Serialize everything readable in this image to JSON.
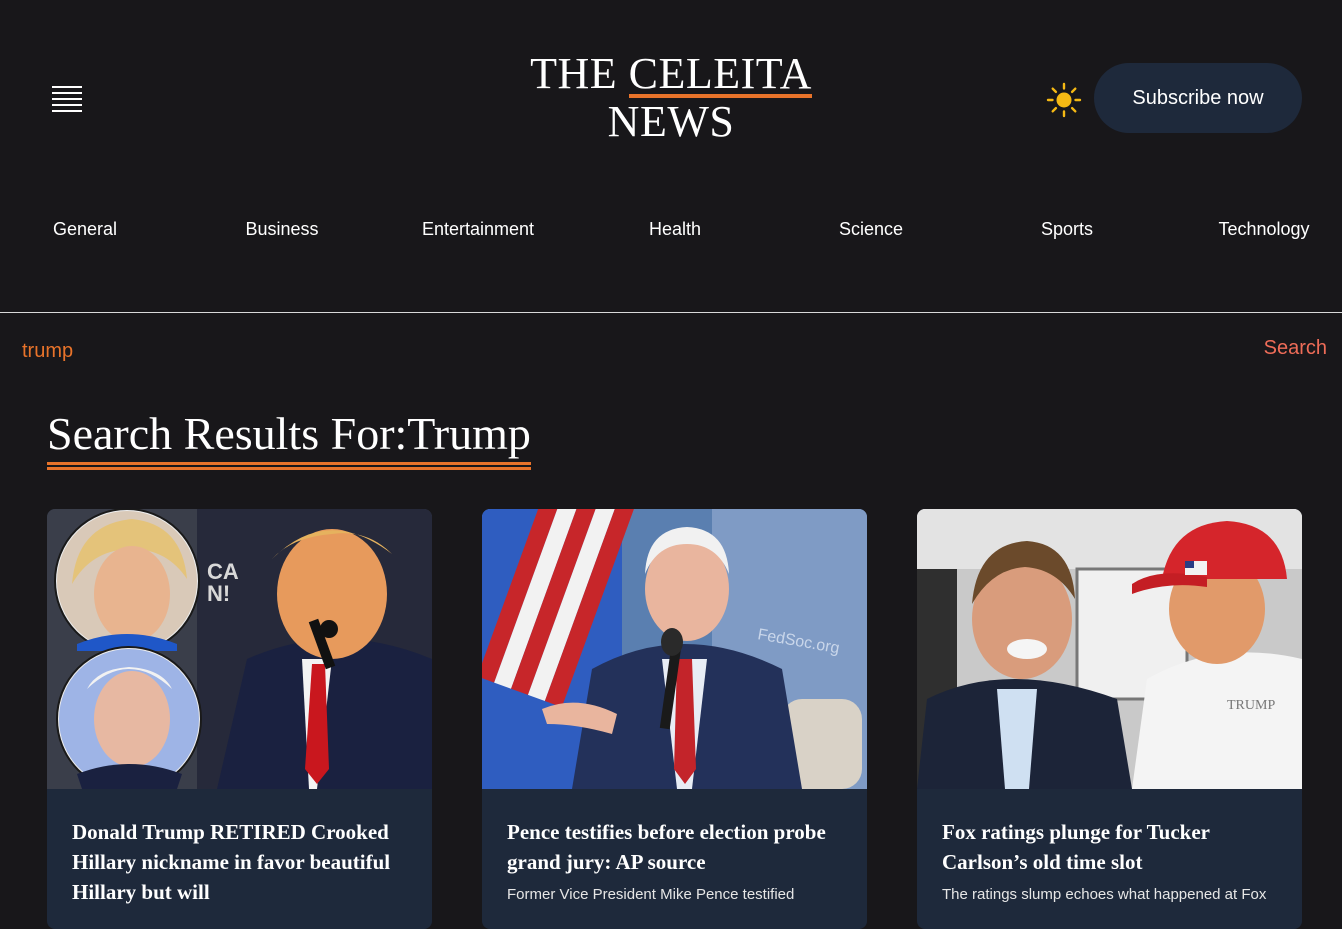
{
  "header": {
    "logo_line1_prefix": "THE ",
    "logo_line1_accent": "CELEITA",
    "logo_line2": "NEWS",
    "subscribe_label": "Subscribe now",
    "menu_icon": "hamburger-menu-icon",
    "theme_icon": "sun-icon"
  },
  "nav": {
    "categories": [
      "General",
      "Business",
      "Entertainment",
      "Health",
      "Science",
      "Sports",
      "Technology"
    ]
  },
  "search": {
    "value": "trump",
    "button_label": "Search"
  },
  "results": {
    "heading": "Search Results For:Trump"
  },
  "cards": [
    {
      "title": "Donald Trump RETIRED Crooked Hillary nickname in favor beautiful Hillary but will",
      "description": ""
    },
    {
      "title": "Pence testifies before election probe grand jury: AP source",
      "description": "Former Vice President Mike Pence testified"
    },
    {
      "title": "Fox ratings plunge for Tucker Carlson’s old time slot",
      "description": "The ratings slump echoes what happened at Fox"
    }
  ],
  "colors": {
    "background": "#18171a",
    "accent": "#e8732a",
    "card_background": "#1e293b",
    "search_button": "#ee6c58",
    "sun": "#f5b914"
  }
}
